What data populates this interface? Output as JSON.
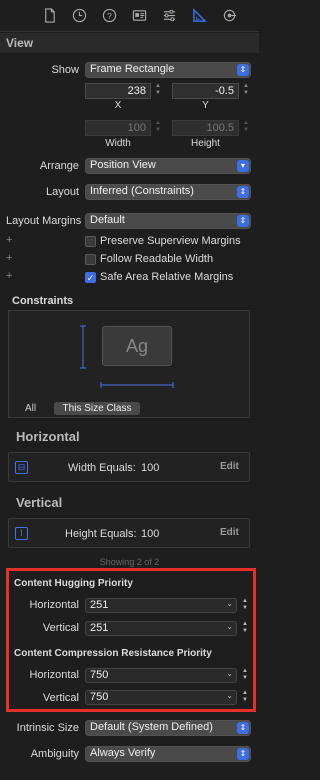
{
  "toolbar": {
    "icons": [
      "document-icon",
      "clock-icon",
      "help-icon",
      "identity-icon",
      "sliders-icon",
      "ruler-icon",
      "connections-icon"
    ]
  },
  "view": {
    "title": "View",
    "show_label": "Show",
    "show_value": "Frame Rectangle",
    "x_value": "238",
    "y_value": "-0.5",
    "x_label": "X",
    "y_label": "Y",
    "width_value": "100",
    "height_value": "100.5",
    "width_label": "Width",
    "height_label": "Height",
    "arrange_label": "Arrange",
    "arrange_value": "Position View",
    "layout_label": "Layout",
    "layout_value": "Inferred (Constraints)",
    "margins_label": "Layout Margins",
    "margins_value": "Default",
    "checkboxes": [
      {
        "label": "Preserve Superview Margins",
        "checked": false
      },
      {
        "label": "Follow Readable Width",
        "checked": false
      },
      {
        "label": "Safe Area Relative Margins",
        "checked": true
      }
    ]
  },
  "constraints": {
    "title": "Constraints",
    "preview_text": "Ag",
    "tab_all": "All",
    "tab_size_class": "This Size Class"
  },
  "horizontal": {
    "title": "Horizontal",
    "text": "Width Equals:",
    "value": "100",
    "edit": "Edit"
  },
  "vertical": {
    "title": "Vertical",
    "text": "Height Equals:",
    "value": "100",
    "edit": "Edit"
  },
  "showing": "Showing 2 of 2",
  "hugging": {
    "title": "Content Hugging Priority",
    "horizontal_label": "Horizontal",
    "horizontal_value": "251",
    "vertical_label": "Vertical",
    "vertical_value": "251"
  },
  "compression": {
    "title": "Content Compression Resistance Priority",
    "horizontal_label": "Horizontal",
    "horizontal_value": "750",
    "vertical_label": "Vertical",
    "vertical_value": "750"
  },
  "intrinsic": {
    "label": "Intrinsic Size",
    "value": "Default (System Defined)"
  },
  "ambiguity": {
    "label": "Ambiguity",
    "value": "Always Verify"
  },
  "colors": {
    "accent": "#3d6ee6",
    "highlight": "#e8302a",
    "background": "#1e1e1e"
  }
}
